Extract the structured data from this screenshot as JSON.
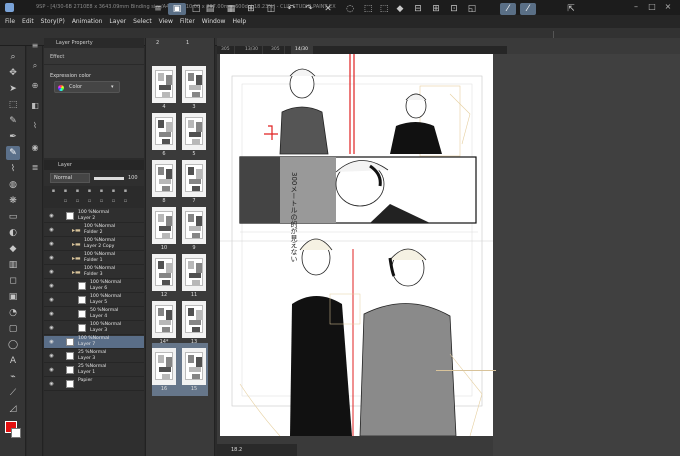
{
  "app": {
    "title": "9SP - [4/30-6B 2710E8 x 3643.09mm Binding size/A4 Size 210.00 x 297.00mm 600dpi 18.23%] - CLIP STUDIO PAINT EX",
    "menu": [
      "File",
      "Edit",
      "Story(P)",
      "Animation",
      "Layer",
      "Select",
      "View",
      "Filter",
      "Window",
      "Help"
    ],
    "window_controls": [
      "–",
      "□",
      "×"
    ]
  },
  "property_panel": {
    "tab_label": "Layer Property",
    "effect_label": "Effect",
    "expression_label": "Expression color",
    "expression_value": "Color"
  },
  "layer_panel": {
    "tab_label": "Layer",
    "blend_mode": "Normal",
    "opacity": "100",
    "layers": [
      {
        "lines": [
          "100 %Normal",
          "Layer 2"
        ],
        "type": "raster",
        "indent": 0,
        "selected": false
      },
      {
        "lines": [
          "100 %Normal",
          "Folder 2"
        ],
        "type": "folder",
        "indent": 1,
        "selected": false
      },
      {
        "lines": [
          "100 %Normal",
          "Layer 2 Copy"
        ],
        "type": "folder",
        "indent": 1,
        "selected": false
      },
      {
        "lines": [
          "100 %Normal",
          "Folder 1"
        ],
        "type": "folder",
        "indent": 1,
        "selected": false
      },
      {
        "lines": [
          "100 %Normal",
          "Folder 3"
        ],
        "type": "folder",
        "indent": 1,
        "selected": false
      },
      {
        "lines": [
          "100 %Normal",
          "Layer 6"
        ],
        "type": "raster",
        "indent": 2,
        "selected": false
      },
      {
        "lines": [
          "100 %Normal",
          "Layer 5"
        ],
        "type": "raster",
        "indent": 2,
        "selected": false
      },
      {
        "lines": [
          "50 %Normal",
          "Layer 4"
        ],
        "type": "raster",
        "indent": 2,
        "selected": false
      },
      {
        "lines": [
          "100 %Normal",
          "Layer 3"
        ],
        "type": "raster",
        "indent": 2,
        "selected": false
      },
      {
        "lines": [
          "100 %Normal",
          "Layer 7"
        ],
        "type": "raster",
        "indent": 0,
        "selected": true
      },
      {
        "lines": [
          "25 %Normal",
          "Layer 3"
        ],
        "type": "raster",
        "indent": 0,
        "selected": false
      },
      {
        "lines": [
          "25 %Normal",
          "Layer 1"
        ],
        "type": "raster",
        "indent": 0,
        "selected": false
      },
      {
        "lines": [
          "Papier"
        ],
        "type": "paper",
        "indent": 0,
        "selected": false
      }
    ]
  },
  "page_manager": {
    "pages": [
      {
        "num": "4",
        "col": 0,
        "row": 0
      },
      {
        "num": "3",
        "col": 1,
        "row": 0
      },
      {
        "num": "6",
        "col": 0,
        "row": 1
      },
      {
        "num": "5",
        "col": 1,
        "row": 1
      },
      {
        "num": "8",
        "col": 0,
        "row": 2
      },
      {
        "num": "7",
        "col": 1,
        "row": 2
      },
      {
        "num": "10",
        "col": 0,
        "row": 3
      },
      {
        "num": "9",
        "col": 1,
        "row": 3
      },
      {
        "num": "12",
        "col": 0,
        "row": 4
      },
      {
        "num": "11",
        "col": 1,
        "row": 4
      },
      {
        "num": "14*",
        "col": 0,
        "row": 5
      },
      {
        "num": "13",
        "col": 1,
        "row": 5
      },
      {
        "num": "16",
        "col": 0,
        "row": 6
      },
      {
        "num": "15",
        "col": 1,
        "row": 6
      }
    ],
    "top_numbers": [
      "2",
      "1"
    ]
  },
  "canvas": {
    "tabs": [
      "305",
      "13/30",
      "305",
      "14/30"
    ],
    "zoom": "18.2",
    "speech_text": "300メートルの的が見えない"
  },
  "colors": {
    "foreground": "#e31010",
    "background": "#ffffff",
    "accent": "#5a6e88"
  }
}
